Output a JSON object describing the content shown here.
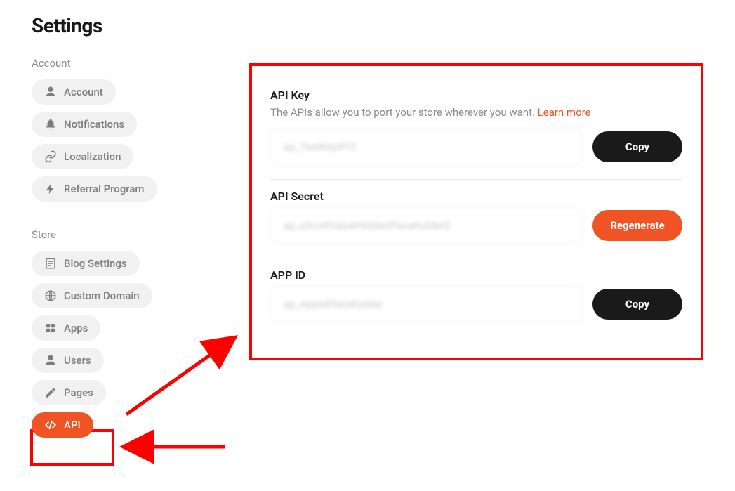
{
  "pageTitle": "Settings",
  "sidebar": {
    "groups": [
      {
        "label": "Account",
        "items": [
          {
            "id": "account",
            "label": "Account",
            "icon": "person-icon",
            "active": false
          },
          {
            "id": "notifications",
            "label": "Notifications",
            "icon": "bell-icon",
            "active": false
          },
          {
            "id": "localization",
            "label": "Localization",
            "icon": "link-icon",
            "active": false
          },
          {
            "id": "referral",
            "label": "Referral Program",
            "icon": "bolt-icon",
            "active": false
          }
        ]
      },
      {
        "label": "Store",
        "items": [
          {
            "id": "blog",
            "label": "Blog Settings",
            "icon": "doc-icon",
            "active": false
          },
          {
            "id": "domain",
            "label": "Custom Domain",
            "icon": "globe-icon",
            "active": false
          },
          {
            "id": "apps",
            "label": "Apps",
            "icon": "grid-icon",
            "active": false
          },
          {
            "id": "users",
            "label": "Users",
            "icon": "person-icon",
            "active": false
          },
          {
            "id": "pages",
            "label": "Pages",
            "icon": "pen-icon",
            "active": false
          },
          {
            "id": "api",
            "label": "API",
            "icon": "code-icon",
            "active": true
          }
        ]
      }
    ]
  },
  "panel": {
    "apiKey": {
      "label": "API Key",
      "description": "The APIs allow you to port your store wherever you want.",
      "learnMore": "Learn more",
      "value": "ap_TestKeyXYZ",
      "buttonLabel": "Copy"
    },
    "apiSecret": {
      "label": "API Secret",
      "value": "ap_s3cretValueHiddenPlaceholder0",
      "buttonLabel": "Regenerate"
    },
    "appId": {
      "label": "APP ID",
      "value": "ap_AppIdPlaceholder",
      "buttonLabel": "Copy"
    }
  },
  "colors": {
    "accent": "#f05324",
    "highlight": "#ff0000"
  }
}
